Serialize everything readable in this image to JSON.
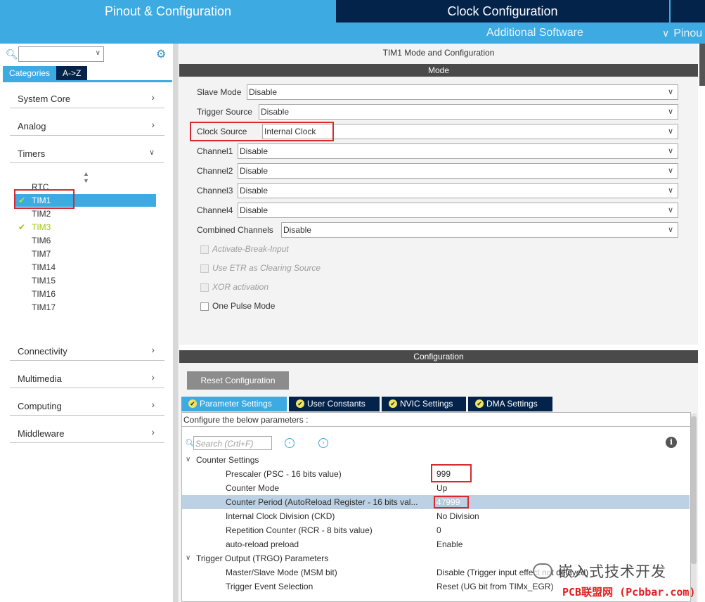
{
  "header": {
    "tab_pinout": "Pinout & Configuration",
    "tab_clock": "Clock Configuration",
    "sub_additional": "Additional Software",
    "sub_pinout": "Pinou"
  },
  "sidebar": {
    "search_value": "",
    "tabs": {
      "categories": "Categories",
      "atoz": "A->Z"
    },
    "categories": [
      {
        "label": "System Core"
      },
      {
        "label": "Analog"
      },
      {
        "label": "Timers"
      },
      {
        "label": "Connectivity"
      },
      {
        "label": "Multimedia"
      },
      {
        "label": "Computing"
      },
      {
        "label": "Middleware"
      }
    ],
    "timers": [
      "RTC",
      "TIM1",
      "TIM2",
      "TIM3",
      "TIM6",
      "TIM7",
      "TIM14",
      "TIM15",
      "TIM16",
      "TIM17"
    ],
    "selected_timer": "TIM1"
  },
  "mode": {
    "title": "TIM1 Mode and Configuration",
    "section": "Mode",
    "rows": [
      {
        "label": "Slave Mode",
        "value": "Disable"
      },
      {
        "label": "Trigger Source",
        "value": "Disable"
      },
      {
        "label": "Clock Source",
        "value": "Internal Clock"
      },
      {
        "label": "Channel1",
        "value": "Disable"
      },
      {
        "label": "Channel2",
        "value": "Disable"
      },
      {
        "label": "Channel3",
        "value": "Disable"
      },
      {
        "label": "Channel4",
        "value": "Disable"
      },
      {
        "label": "Combined Channels",
        "value": "Disable"
      }
    ],
    "checks": [
      {
        "label": "Activate-Break-Input",
        "enabled": false
      },
      {
        "label": "Use ETR as Clearing Source",
        "enabled": false
      },
      {
        "label": "XOR activation",
        "enabled": false
      },
      {
        "label": "One Pulse Mode",
        "enabled": true
      }
    ]
  },
  "config": {
    "section": "Configuration",
    "reset_label": "Reset Configuration",
    "tabs": [
      {
        "label": "Parameter Settings"
      },
      {
        "label": "User Constants"
      },
      {
        "label": "NVIC Settings"
      },
      {
        "label": "DMA Settings"
      }
    ],
    "header_text": "Configure the below parameters :",
    "search_placeholder": "Search (Crtl+F)",
    "info_label": "i",
    "params": [
      {
        "name": "Counter Settings",
        "value": ""
      },
      {
        "name": "Prescaler (PSC - 16 bits value)",
        "value": "999"
      },
      {
        "name": "Counter Mode",
        "value": "Up"
      },
      {
        "name": "Counter Period (AutoReload Register - 16 bits val...",
        "value": "47999"
      },
      {
        "name": "Internal Clock Division (CKD)",
        "value": "No Division"
      },
      {
        "name": "Repetition Counter (RCR - 8 bits value)",
        "value": "0"
      },
      {
        "name": "auto-reload preload",
        "value": "Enable"
      },
      {
        "name": "Trigger Output (TRGO) Parameters",
        "value": ""
      },
      {
        "name": "Master/Slave Mode (MSM bit)",
        "value": "Disable (Trigger input effect not delayed)"
      },
      {
        "name": "Trigger Event Selection",
        "value": "Reset (UG bit from TIMx_EGR)"
      }
    ]
  },
  "watermark": {
    "text": "嵌入式技术开发",
    "site": "PCB联盟网 (Pcbbar.com)"
  }
}
